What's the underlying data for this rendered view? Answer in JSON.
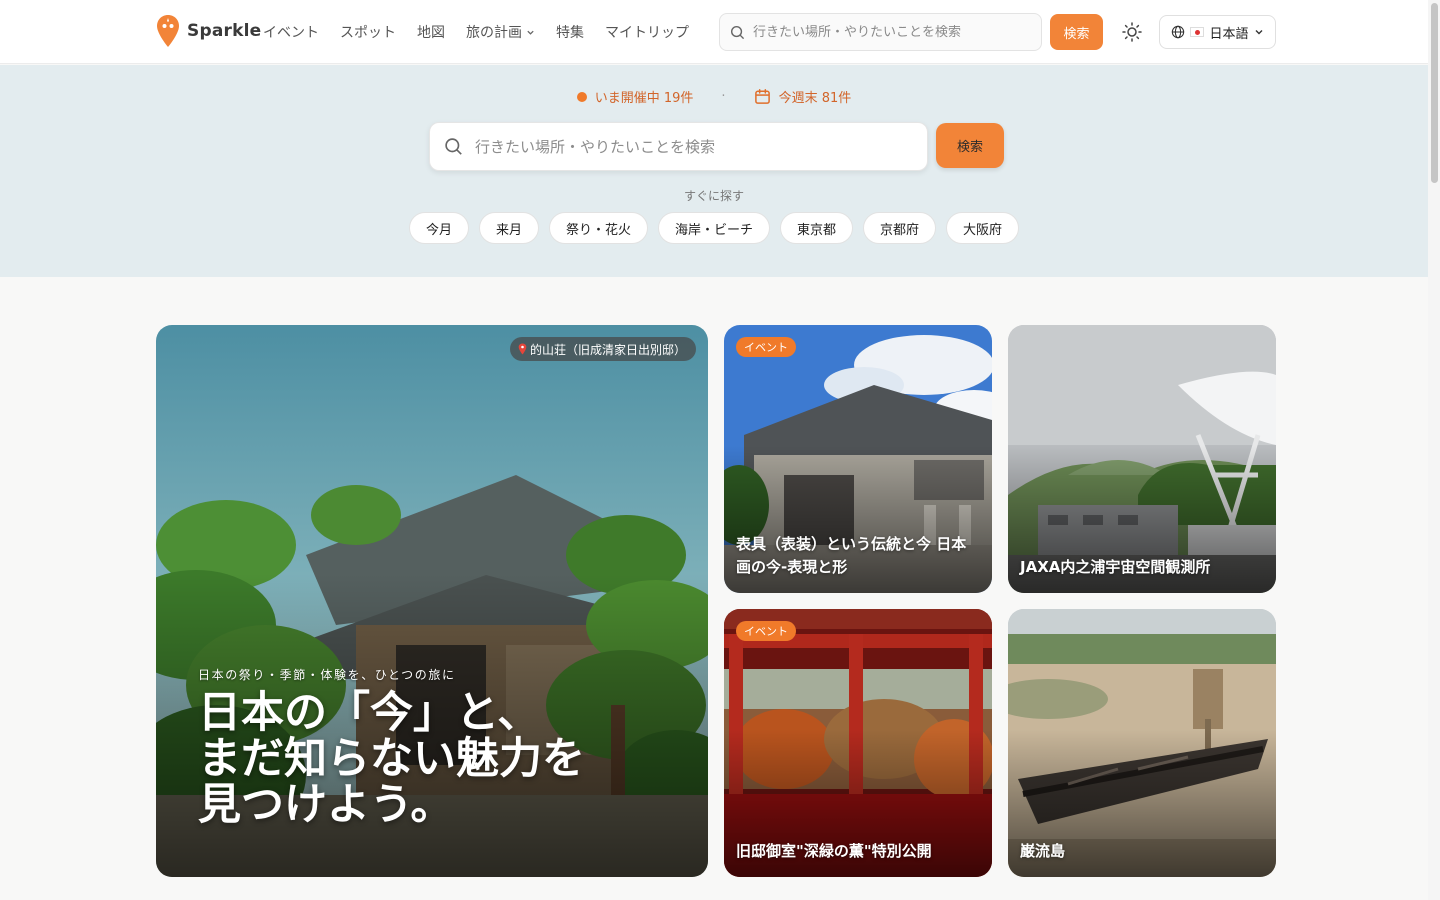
{
  "header": {
    "brand": "Sparkle",
    "nav": [
      {
        "label": "イベント"
      },
      {
        "label": "スポット"
      },
      {
        "label": "地図"
      },
      {
        "label": "旅の計画"
      },
      {
        "label": "特集"
      },
      {
        "label": "マイトリップ"
      }
    ],
    "search_placeholder": "行きたい場所・やりたいことを検索",
    "search_button": "検索",
    "language": "日本語",
    "theme_icon": "sun-icon"
  },
  "hero_search": {
    "live_now": "いま開催中 19件",
    "this_weekend": "今週末 81件",
    "separator": "·",
    "placeholder": "行きたい場所・やりたいことを検索",
    "button": "検索",
    "quick_label": "すぐに探す",
    "chips": [
      "今月",
      "来月",
      "祭り・花火",
      "海岸・ビーチ",
      "東京都",
      "京都府",
      "大阪府"
    ]
  },
  "feature": {
    "location": "的山荘（旧成清家日出別邸）",
    "subtitle": "日本の祭り・季節・体験を、ひとつの旅に",
    "headline": [
      "日本の「今」と、",
      "まだ知らない魅力を",
      "見つけよう。"
    ]
  },
  "cards": [
    {
      "badge": "イベント",
      "title": "表具（表装）という伝統と今 日本画の今-表現と形"
    },
    {
      "badge": "",
      "title": "JAXA内之浦宇宙空間観測所"
    },
    {
      "badge": "イベント",
      "title": "旧邸御室\"深緑の薫\"特別公開"
    },
    {
      "badge": "",
      "title": "巌流島"
    }
  ],
  "colors": {
    "accent": "#f28438",
    "band": "#e3ecef",
    "stat_text": "#d2652a"
  }
}
